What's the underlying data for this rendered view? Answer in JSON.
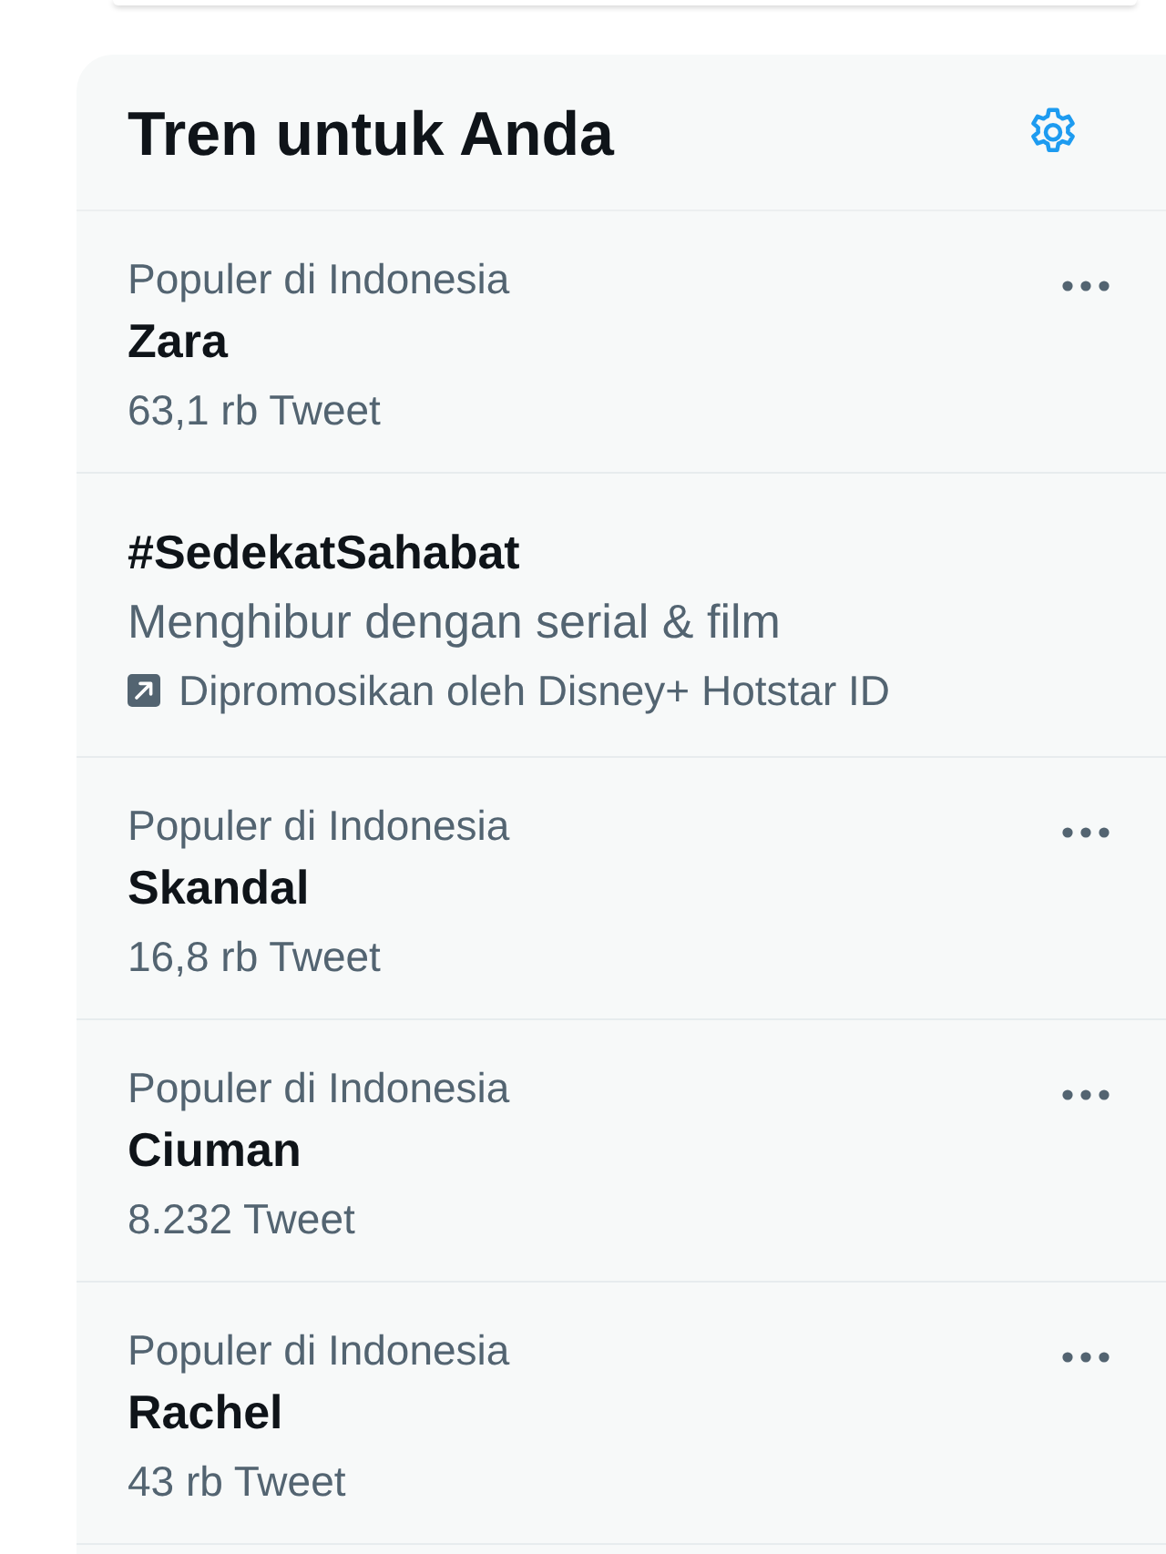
{
  "header": {
    "title": "Tren untuk Anda"
  },
  "trends": [
    {
      "kind": "trend",
      "context": "Populer di Indonesia",
      "name": "Zara",
      "count": "63,1 rb Tweet"
    },
    {
      "kind": "promoted",
      "name": "#SedekatSahabat",
      "description": "Menghibur dengan serial & film",
      "promoted_by": "Dipromosikan oleh Disney+ Hotstar ID"
    },
    {
      "kind": "trend",
      "context": "Populer di Indonesia",
      "name": "Skandal",
      "count": "16,8 rb Tweet"
    },
    {
      "kind": "trend",
      "context": "Populer di Indonesia",
      "name": "Ciuman",
      "count": "8.232 Tweet"
    },
    {
      "kind": "trend",
      "context": "Populer di Indonesia",
      "name": "Rachel",
      "count": "43 rb Tweet"
    }
  ]
}
